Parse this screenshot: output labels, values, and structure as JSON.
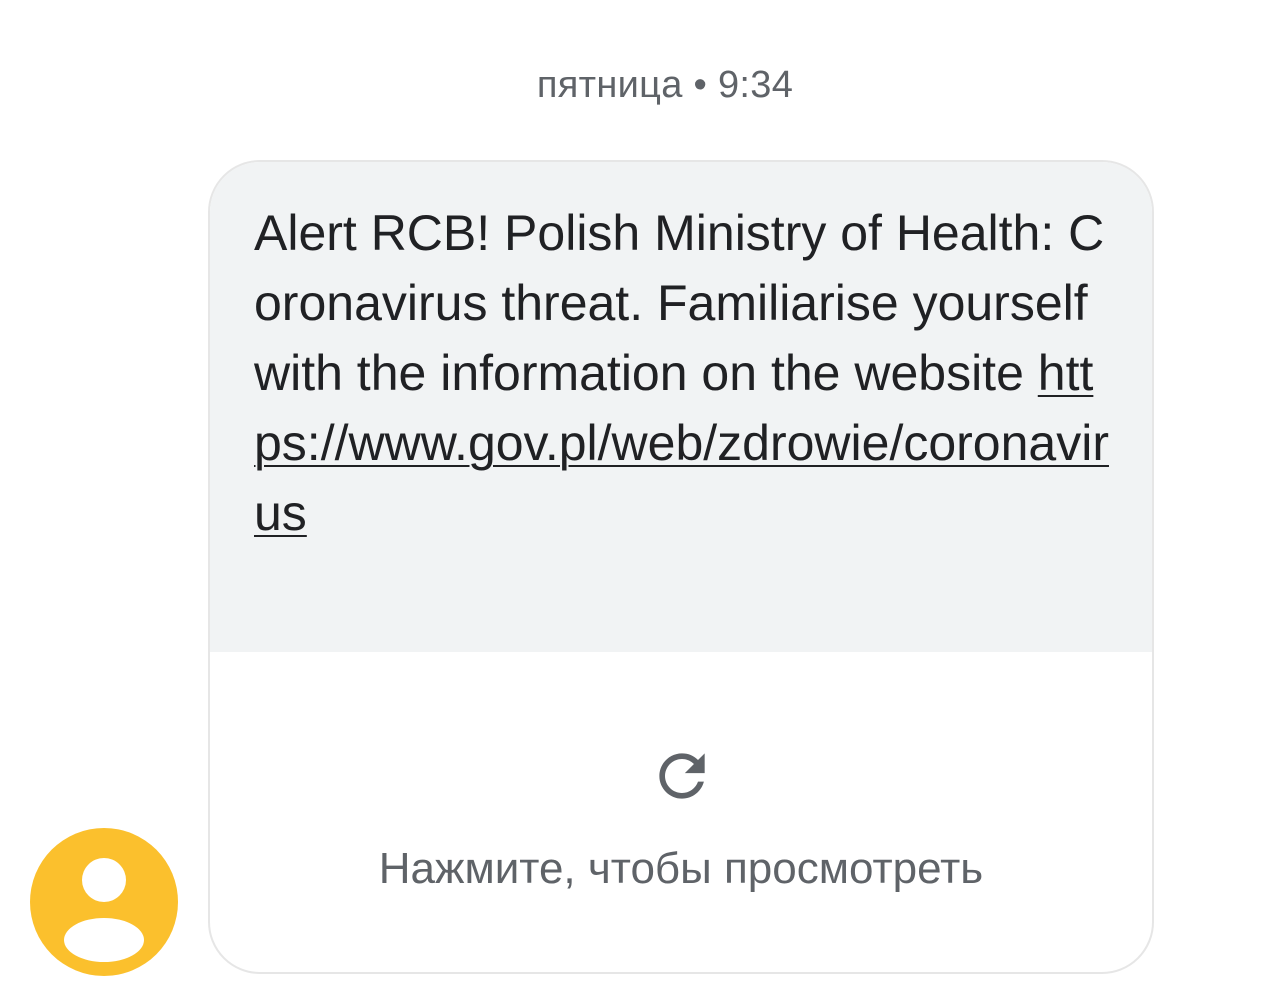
{
  "conversation": {
    "timestamp": "пятница • 9:34"
  },
  "message": {
    "text": "Alert RCB! Polish Ministry of Health: Coronavirus threat. Familiarise yourself with the information on the website ",
    "link_text": "https://www.gov.pl/web/zdrowie/coronavirus",
    "preview_label": "Нажмите, чтобы просмотреть",
    "preview_icon": "refresh-icon"
  },
  "sender": {
    "avatar_icon": "person-icon",
    "avatar_color": "#fbc02d"
  },
  "colors": {
    "bubble_background": "#f1f3f4",
    "text": "#202124",
    "secondary_text": "#5f6368"
  }
}
